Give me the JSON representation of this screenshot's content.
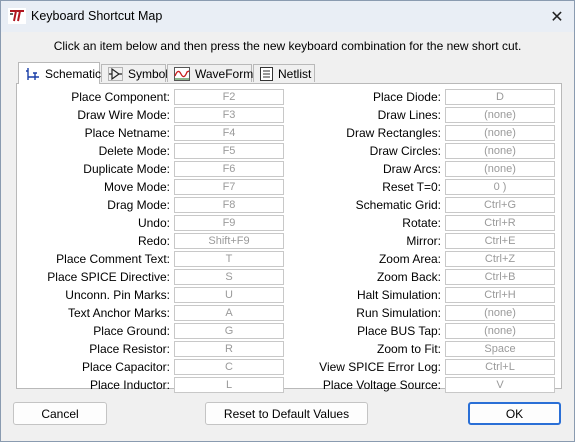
{
  "window": {
    "title": "Keyboard Shortcut Map"
  },
  "instruction": "Click an item below and then press the new keyboard combination for the new short cut.",
  "tabs": [
    {
      "label": "Schematic",
      "icon": "schematic-icon",
      "active": true
    },
    {
      "label": "Symbol",
      "icon": "symbol-icon",
      "active": false
    },
    {
      "label": "WaveForm",
      "icon": "waveform-icon",
      "active": false
    },
    {
      "label": "Netlist",
      "icon": "netlist-icon",
      "active": false
    }
  ],
  "left_shortcuts": [
    {
      "label": "Place Component:",
      "value": "F2"
    },
    {
      "label": "Draw Wire Mode:",
      "value": "F3"
    },
    {
      "label": "Place Netname:",
      "value": "F4"
    },
    {
      "label": "Delete Mode:",
      "value": "F5"
    },
    {
      "label": "Duplicate Mode:",
      "value": "F6"
    },
    {
      "label": "Move Mode:",
      "value": "F7"
    },
    {
      "label": "Drag Mode:",
      "value": "F8"
    },
    {
      "label": "Undo:",
      "value": "F9"
    },
    {
      "label": "Redo:",
      "value": "Shift+F9"
    },
    {
      "label": "Place Comment Text:",
      "value": "T"
    },
    {
      "label": "Place SPICE Directive:",
      "value": "S"
    },
    {
      "label": "Unconn. Pin Marks:",
      "value": "U"
    },
    {
      "label": "Text Anchor Marks:",
      "value": "A"
    },
    {
      "label": "Place Ground:",
      "value": "G"
    },
    {
      "label": "Place Resistor:",
      "value": "R"
    },
    {
      "label": "Place Capacitor:",
      "value": "C"
    },
    {
      "label": "Place Inductor:",
      "value": "L"
    }
  ],
  "right_shortcuts": [
    {
      "label": "Place Diode:",
      "value": "D"
    },
    {
      "label": "Draw Lines:",
      "value": "(none)"
    },
    {
      "label": "Draw Rectangles:",
      "value": "(none)"
    },
    {
      "label": "Draw Circles:",
      "value": "(none)"
    },
    {
      "label": "Draw Arcs:",
      "value": "(none)"
    },
    {
      "label": "Reset T=0:",
      "value": "0 )"
    },
    {
      "label": "Schematic Grid:",
      "value": "Ctrl+G"
    },
    {
      "label": "Rotate:",
      "value": "Ctrl+R"
    },
    {
      "label": "Mirror:",
      "value": "Ctrl+E"
    },
    {
      "label": "Zoom Area:",
      "value": "Ctrl+Z"
    },
    {
      "label": "Zoom Back:",
      "value": "Ctrl+B"
    },
    {
      "label": "Halt Simulation:",
      "value": "Ctrl+H"
    },
    {
      "label": "Run Simulation:",
      "value": "(none)"
    },
    {
      "label": "Place BUS Tap:",
      "value": "(none)"
    },
    {
      "label": "Zoom to Fit:",
      "value": "Space"
    },
    {
      "label": "View SPICE Error Log:",
      "value": "Ctrl+L"
    },
    {
      "label": "Place Voltage Source:",
      "value": "V"
    }
  ],
  "buttons": {
    "cancel": "Cancel",
    "reset": "Reset to Default Values",
    "ok": "OK"
  },
  "colors": {
    "accent": "#2a6fd6",
    "field_text": "#9a9a9a"
  }
}
